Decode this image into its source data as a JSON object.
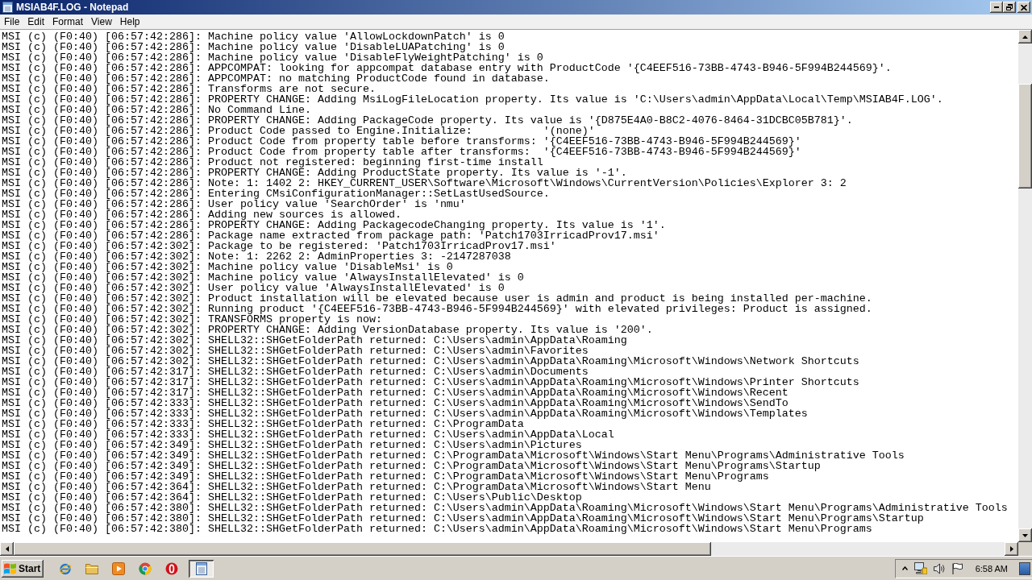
{
  "window": {
    "title": "MSIAB4F.LOG - Notepad"
  },
  "menu": [
    "File",
    "Edit",
    "Format",
    "View",
    "Help"
  ],
  "lines": [
    "MSI (c) (F0:40) [06:57:42:286]: Machine policy value 'AllowLockdownPatch' is 0",
    "MSI (c) (F0:40) [06:57:42:286]: Machine policy value 'DisableLUAPatching' is 0",
    "MSI (c) (F0:40) [06:57:42:286]: Machine policy value 'DisableFlyWeightPatching' is 0",
    "MSI (c) (F0:40) [06:57:42:286]: APPCOMPAT: looking for appcompat database entry with ProductCode '{C4EEF516-73BB-4743-B946-5F994B244569}'.",
    "MSI (c) (F0:40) [06:57:42:286]: APPCOMPAT: no matching ProductCode found in database.",
    "MSI (c) (F0:40) [06:57:42:286]: Transforms are not secure.",
    "MSI (c) (F0:40) [06:57:42:286]: PROPERTY CHANGE: Adding MsiLogFileLocation property. Its value is 'C:\\Users\\admin\\AppData\\Local\\Temp\\MSIAB4F.LOG'.",
    "MSI (c) (F0:40) [06:57:42:286]: No Command Line.",
    "MSI (c) (F0:40) [06:57:42:286]: PROPERTY CHANGE: Adding PackageCode property. Its value is '{D875E4A0-B8C2-4076-8464-31DCBC05B781}'.",
    "MSI (c) (F0:40) [06:57:42:286]: Product Code passed to Engine.Initialize:           '(none)'",
    "MSI (c) (F0:40) [06:57:42:286]: Product Code from property table before transforms: '{C4EEF516-73BB-4743-B946-5F994B244569}'",
    "MSI (c) (F0:40) [06:57:42:286]: Product Code from property table after transforms:  '{C4EEF516-73BB-4743-B946-5F994B244569}'",
    "MSI (c) (F0:40) [06:57:42:286]: Product not registered: beginning first-time install",
    "MSI (c) (F0:40) [06:57:42:286]: PROPERTY CHANGE: Adding ProductState property. Its value is '-1'.",
    "MSI (c) (F0:40) [06:57:42:286]: Note: 1: 1402 2: HKEY_CURRENT_USER\\Software\\Microsoft\\Windows\\CurrentVersion\\Policies\\Explorer 3: 2",
    "MSI (c) (F0:40) [06:57:42:286]: Entering CMsiConfigurationManager::SetLastUsedSource.",
    "MSI (c) (F0:40) [06:57:42:286]: User policy value 'SearchOrder' is 'nmu'",
    "MSI (c) (F0:40) [06:57:42:286]: Adding new sources is allowed.",
    "MSI (c) (F0:40) [06:57:42:286]: PROPERTY CHANGE: Adding PackagecodeChanging property. Its value is '1'.",
    "MSI (c) (F0:40) [06:57:42:286]: Package name extracted from package path: 'Patch1703IrricadProv17.msi'",
    "MSI (c) (F0:40) [06:57:42:302]: Package to be registered: 'Patch1703IrricadProv17.msi'",
    "MSI (c) (F0:40) [06:57:42:302]: Note: 1: 2262 2: AdminProperties 3: -2147287038",
    "MSI (c) (F0:40) [06:57:42:302]: Machine policy value 'DisableMsi' is 0",
    "MSI (c) (F0:40) [06:57:42:302]: Machine policy value 'AlwaysInstallElevated' is 0",
    "MSI (c) (F0:40) [06:57:42:302]: User policy value 'AlwaysInstallElevated' is 0",
    "MSI (c) (F0:40) [06:57:42:302]: Product installation will be elevated because user is admin and product is being installed per-machine.",
    "MSI (c) (F0:40) [06:57:42:302]: Running product '{C4EEF516-73BB-4743-B946-5F994B244569}' with elevated privileges: Product is assigned.",
    "MSI (c) (F0:40) [06:57:42:302]: TRANSFORMS property is now:",
    "MSI (c) (F0:40) [06:57:42:302]: PROPERTY CHANGE: Adding VersionDatabase property. Its value is '200'.",
    "MSI (c) (F0:40) [06:57:42:302]: SHELL32::SHGetFolderPath returned: C:\\Users\\admin\\AppData\\Roaming",
    "MSI (c) (F0:40) [06:57:42:302]: SHELL32::SHGetFolderPath returned: C:\\Users\\admin\\Favorites",
    "MSI (c) (F0:40) [06:57:42:302]: SHELL32::SHGetFolderPath returned: C:\\Users\\admin\\AppData\\Roaming\\Microsoft\\Windows\\Network Shortcuts",
    "MSI (c) (F0:40) [06:57:42:317]: SHELL32::SHGetFolderPath returned: C:\\Users\\admin\\Documents",
    "MSI (c) (F0:40) [06:57:42:317]: SHELL32::SHGetFolderPath returned: C:\\Users\\admin\\AppData\\Roaming\\Microsoft\\Windows\\Printer Shortcuts",
    "MSI (c) (F0:40) [06:57:42:317]: SHELL32::SHGetFolderPath returned: C:\\Users\\admin\\AppData\\Roaming\\Microsoft\\Windows\\Recent",
    "MSI (c) (F0:40) [06:57:42:333]: SHELL32::SHGetFolderPath returned: C:\\Users\\admin\\AppData\\Roaming\\Microsoft\\Windows\\SendTo",
    "MSI (c) (F0:40) [06:57:42:333]: SHELL32::SHGetFolderPath returned: C:\\Users\\admin\\AppData\\Roaming\\Microsoft\\Windows\\Templates",
    "MSI (c) (F0:40) [06:57:42:333]: SHELL32::SHGetFolderPath returned: C:\\ProgramData",
    "MSI (c) (F0:40) [06:57:42:333]: SHELL32::SHGetFolderPath returned: C:\\Users\\admin\\AppData\\Local",
    "MSI (c) (F0:40) [06:57:42:349]: SHELL32::SHGetFolderPath returned: C:\\Users\\admin\\Pictures",
    "MSI (c) (F0:40) [06:57:42:349]: SHELL32::SHGetFolderPath returned: C:\\ProgramData\\Microsoft\\Windows\\Start Menu\\Programs\\Administrative Tools",
    "MSI (c) (F0:40) [06:57:42:349]: SHELL32::SHGetFolderPath returned: C:\\ProgramData\\Microsoft\\Windows\\Start Menu\\Programs\\Startup",
    "MSI (c) (F0:40) [06:57:42:349]: SHELL32::SHGetFolderPath returned: C:\\ProgramData\\Microsoft\\Windows\\Start Menu\\Programs",
    "MSI (c) (F0:40) [06:57:42:364]: SHELL32::SHGetFolderPath returned: C:\\ProgramData\\Microsoft\\Windows\\Start Menu",
    "MSI (c) (F0:40) [06:57:42:364]: SHELL32::SHGetFolderPath returned: C:\\Users\\Public\\Desktop",
    "MSI (c) (F0:40) [06:57:42:380]: SHELL32::SHGetFolderPath returned: C:\\Users\\admin\\AppData\\Roaming\\Microsoft\\Windows\\Start Menu\\Programs\\Administrative Tools",
    "MSI (c) (F0:40) [06:57:42:380]: SHELL32::SHGetFolderPath returned: C:\\Users\\admin\\AppData\\Roaming\\Microsoft\\Windows\\Start Menu\\Programs\\Startup",
    "MSI (c) (F0:40) [06:57:42:380]: SHELL32::SHGetFolderPath returned: C:\\Users\\admin\\AppData\\Roaming\\Microsoft\\Windows\\Start Menu\\Programs"
  ],
  "taskbar": {
    "start": "Start",
    "tasks": [
      {
        "kind": "notepad",
        "selected": true
      }
    ],
    "clock": "6:58 AM"
  }
}
